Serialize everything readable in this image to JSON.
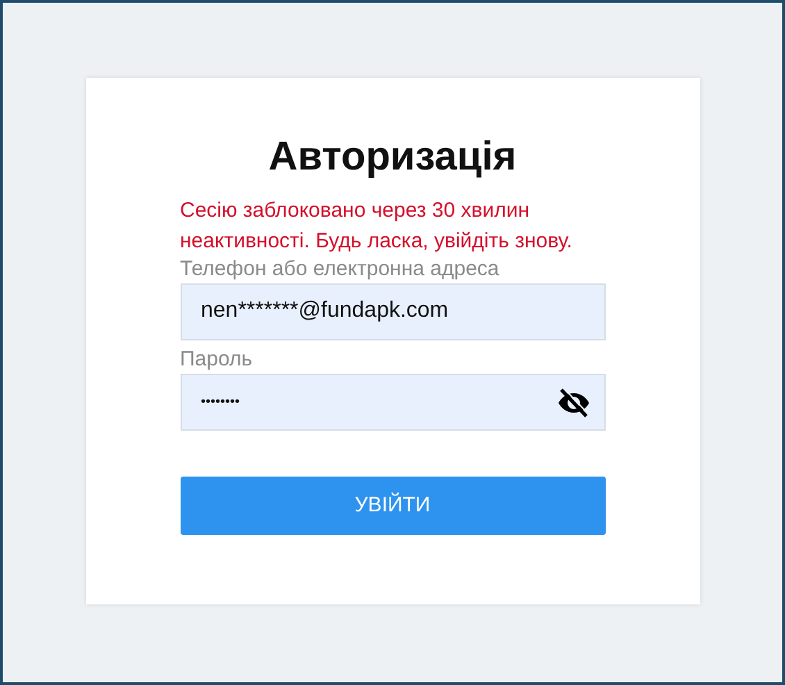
{
  "title": "Авторизація",
  "error_message": "Сесію заблоковано через 30 хвилин неактивності. Будь ласка, увійдіть знову.",
  "fields": [
    {
      "label": "Телефон або електронна адреса",
      "value": "nen*******@fundapk.com",
      "kind": "text"
    },
    {
      "label": "Пароль",
      "value": "••••••••",
      "kind": "password"
    }
  ],
  "submit_button": "УВІЙТИ"
}
